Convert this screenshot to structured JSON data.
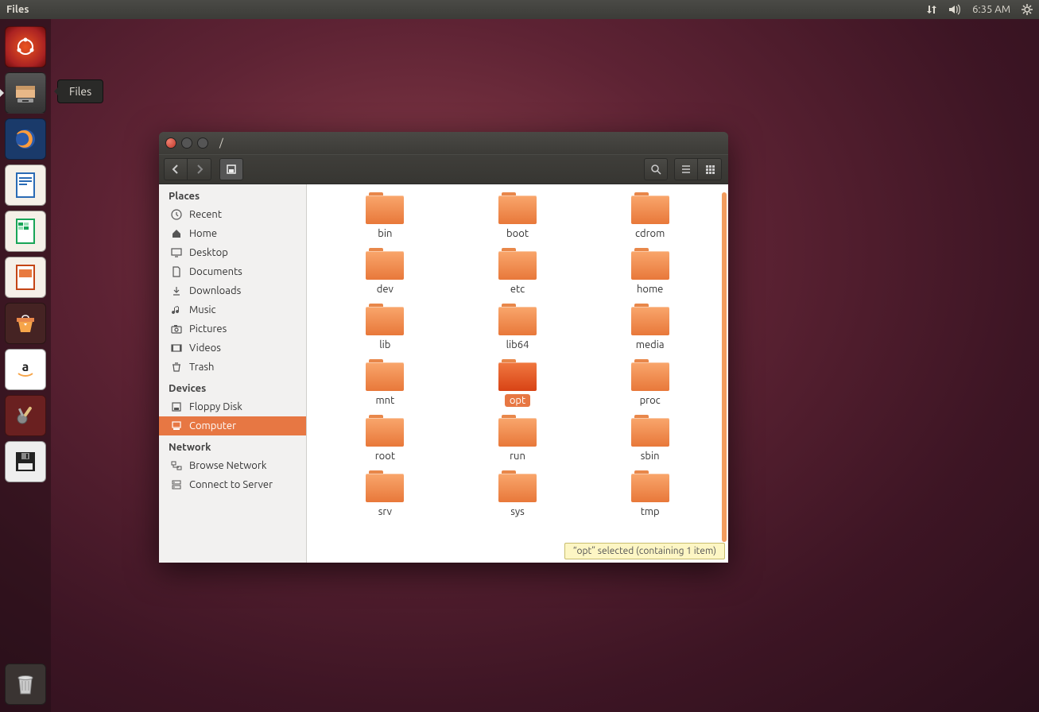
{
  "topbar": {
    "app_title": "Files",
    "time": "6:35 AM"
  },
  "launcher": {
    "tooltip": "Files",
    "items": [
      {
        "id": "dash",
        "name": "Ubuntu Dash"
      },
      {
        "id": "files",
        "name": "Files",
        "active": true
      },
      {
        "id": "firefox",
        "name": "Firefox"
      },
      {
        "id": "writer",
        "name": "LibreOffice Writer"
      },
      {
        "id": "calc",
        "name": "LibreOffice Calc"
      },
      {
        "id": "impress",
        "name": "LibreOffice Impress"
      },
      {
        "id": "software",
        "name": "Ubuntu Software"
      },
      {
        "id": "amazon",
        "name": "Amazon"
      },
      {
        "id": "settings",
        "name": "System Settings"
      },
      {
        "id": "floppy",
        "name": "Floppy"
      }
    ],
    "trash": "Trash"
  },
  "window": {
    "title": "/",
    "sidebar": {
      "sections": [
        {
          "header": "Places",
          "items": [
            {
              "label": "Recent",
              "icon": "clock"
            },
            {
              "label": "Home",
              "icon": "home"
            },
            {
              "label": "Desktop",
              "icon": "desktop"
            },
            {
              "label": "Documents",
              "icon": "doc"
            },
            {
              "label": "Downloads",
              "icon": "download"
            },
            {
              "label": "Music",
              "icon": "music"
            },
            {
              "label": "Pictures",
              "icon": "camera"
            },
            {
              "label": "Videos",
              "icon": "video"
            },
            {
              "label": "Trash",
              "icon": "trash"
            }
          ]
        },
        {
          "header": "Devices",
          "items": [
            {
              "label": "Floppy Disk",
              "icon": "floppy"
            },
            {
              "label": "Computer",
              "icon": "computer",
              "selected": true
            }
          ]
        },
        {
          "header": "Network",
          "items": [
            {
              "label": "Browse Network",
              "icon": "network"
            },
            {
              "label": "Connect to Server",
              "icon": "server"
            }
          ]
        }
      ]
    },
    "folders": [
      {
        "name": "bin"
      },
      {
        "name": "boot"
      },
      {
        "name": "cdrom"
      },
      {
        "name": "dev"
      },
      {
        "name": "etc"
      },
      {
        "name": "home"
      },
      {
        "name": "lib"
      },
      {
        "name": "lib64"
      },
      {
        "name": "media"
      },
      {
        "name": "mnt"
      },
      {
        "name": "opt",
        "selected": true
      },
      {
        "name": "proc"
      },
      {
        "name": "root"
      },
      {
        "name": "run"
      },
      {
        "name": "sbin"
      },
      {
        "name": "srv"
      },
      {
        "name": "sys"
      },
      {
        "name": "tmp"
      }
    ],
    "status": "“opt” selected  (containing 1 item)"
  }
}
